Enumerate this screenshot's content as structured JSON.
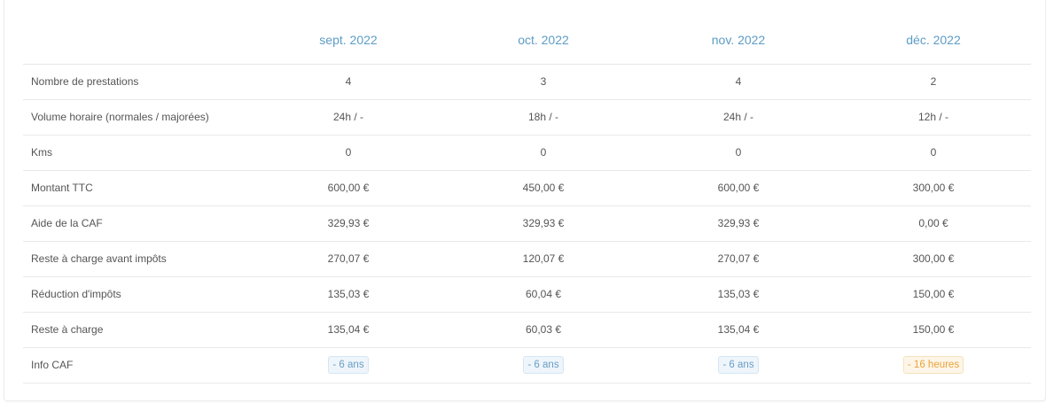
{
  "colors": {
    "header_text": "#5d9cc6",
    "badge_info": "#6a9ec4",
    "badge_warn": "#e9a23b"
  },
  "table": {
    "months": [
      "sept. 2022",
      "oct. 2022",
      "nov. 2022",
      "déc. 2022"
    ],
    "rows": [
      {
        "label": "Nombre de prestations",
        "values": [
          "4",
          "3",
          "4",
          "2"
        ]
      },
      {
        "label": "Volume horaire (normales / majorées)",
        "values": [
          "24h / -",
          "18h / -",
          "24h / -",
          "12h / -"
        ]
      },
      {
        "label": "Kms",
        "values": [
          "0",
          "0",
          "0",
          "0"
        ]
      },
      {
        "label": "Montant TTC",
        "values": [
          "600,00 €",
          "450,00 €",
          "600,00 €",
          "300,00 €"
        ]
      },
      {
        "label": "Aide de la CAF",
        "values": [
          "329,93 €",
          "329,93 €",
          "329,93 €",
          "0,00 €"
        ]
      },
      {
        "label": "Reste à charge avant impôts",
        "values": [
          "270,07 €",
          "120,07 €",
          "270,07 €",
          "300,00 €"
        ]
      },
      {
        "label": "Réduction d'impôts",
        "values": [
          "135,03 €",
          "60,04 €",
          "135,03 €",
          "150,00 €"
        ]
      },
      {
        "label": "Reste à charge",
        "values": [
          "135,04 €",
          "60,03 €",
          "135,04 €",
          "150,00 €"
        ]
      }
    ],
    "info_caf": {
      "label": "Info CAF",
      "badges": [
        {
          "text": "- 6 ans",
          "kind": "info"
        },
        {
          "text": "- 6 ans",
          "kind": "info"
        },
        {
          "text": "- 6 ans",
          "kind": "info"
        },
        {
          "text": "- 16 heures",
          "kind": "warn"
        }
      ]
    }
  }
}
